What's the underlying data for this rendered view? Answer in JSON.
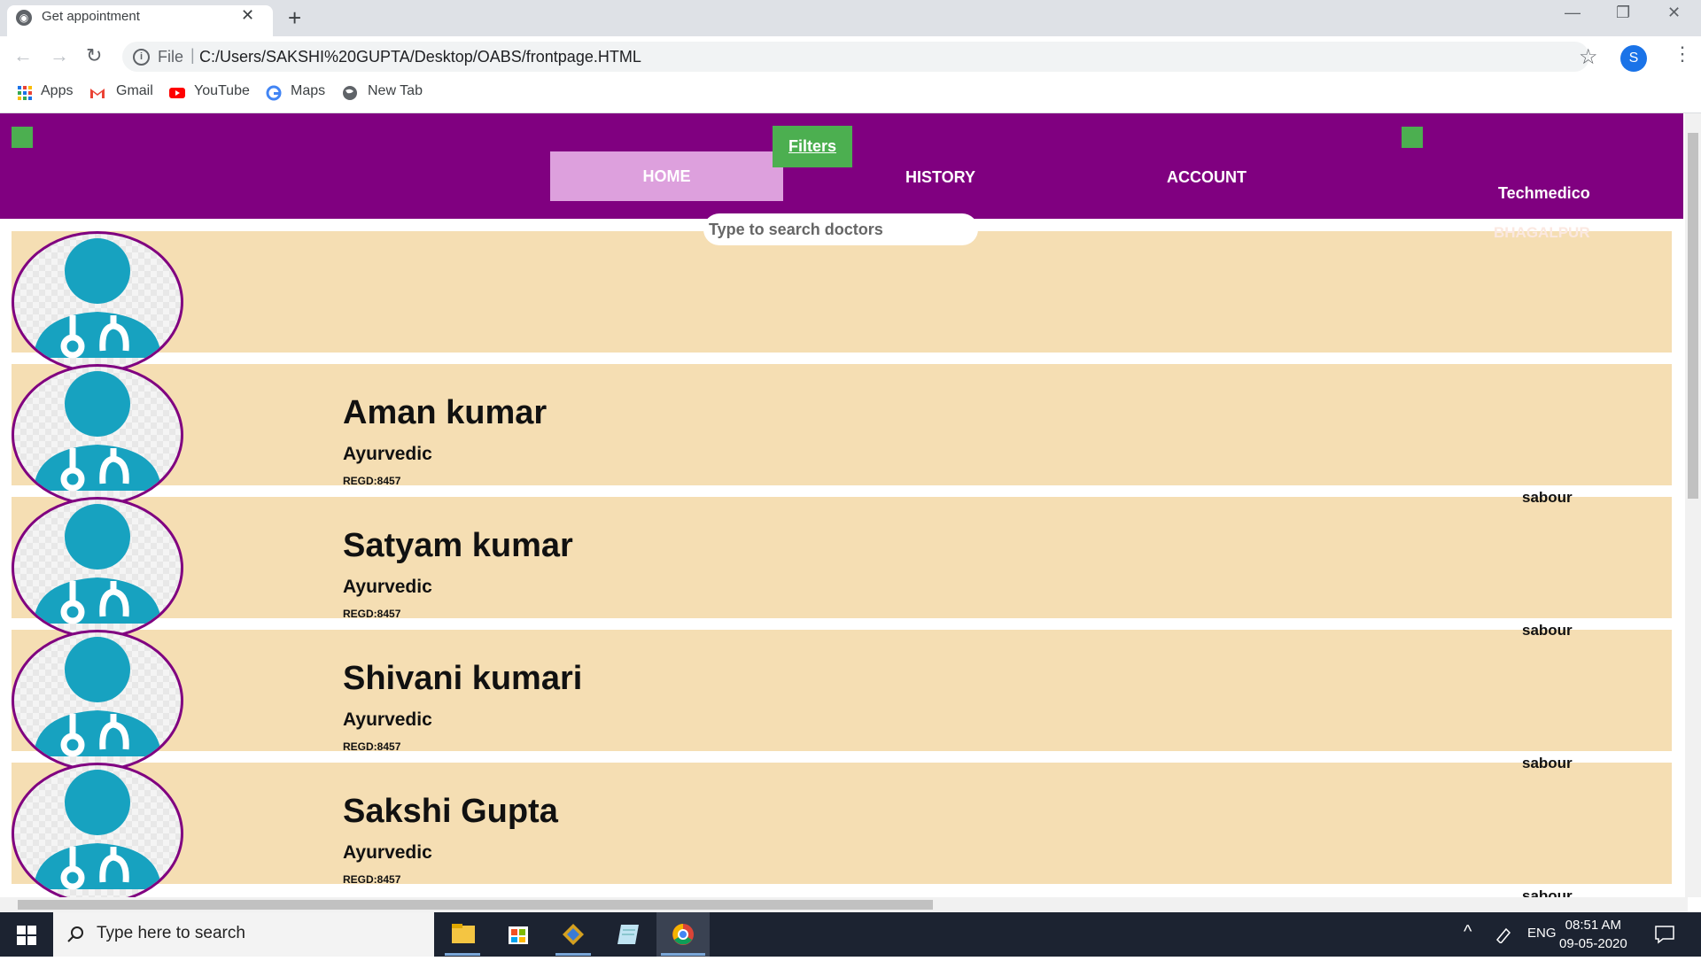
{
  "browser": {
    "tab_title": "Get appointment",
    "tab_close": "✕",
    "new_tab": "+",
    "window_controls": {
      "minimize": "—",
      "restore": "❐",
      "close": "✕"
    },
    "nav": {
      "back": "←",
      "forward": "→",
      "reload": "↻"
    },
    "omnibox": {
      "file_label": "File",
      "separator": "|",
      "url": "C:/Users/SAKSHI%20GUPTA/Desktop/OABS/frontpage.HTML"
    },
    "profile_initial": "S",
    "star": "☆",
    "menu": "⋮",
    "bookmarks": [
      {
        "label": "Apps",
        "icon": "apps-grid-icon"
      },
      {
        "label": "Gmail",
        "icon": "gmail-icon"
      },
      {
        "label": "YouTube",
        "icon": "youtube-icon"
      },
      {
        "label": "Maps",
        "icon": "google-icon"
      },
      {
        "label": "New Tab",
        "icon": "globe-icon"
      }
    ]
  },
  "page": {
    "nav": {
      "home": "HOME",
      "filters": "Filters ",
      "history": "HISTORY",
      "account": "ACCOUNT"
    },
    "brand": "Techmedico",
    "brand_sub": "BHAGALPUR",
    "search_placeholder": "Type to search doctors",
    "doctors": [
      {
        "name": "",
        "specialty": "",
        "regd": "",
        "location": ""
      },
      {
        "name": "Aman kumar",
        "specialty": "Ayurvedic",
        "regd": "REGD:8457",
        "location": "sabour"
      },
      {
        "name": "Satyam kumar",
        "specialty": "Ayurvedic",
        "regd": "REGD:8457",
        "location": "sabour"
      },
      {
        "name": "Shivani kumari",
        "specialty": "Ayurvedic",
        "regd": "REGD:8457",
        "location": "sabour"
      },
      {
        "name": "Sakshi Gupta",
        "specialty": "Ayurvedic",
        "regd": "REGD:8457",
        "location": "sabour"
      }
    ],
    "colors": {
      "header": "#800080",
      "card": "#f5deb3",
      "accent_green": "#4caf50",
      "home_active": "#dda0dd",
      "avatar_teal": "#17a2c0"
    }
  },
  "taskbar": {
    "search_placeholder": "Type here to search",
    "language": "ENG",
    "time": "08:51 AM",
    "date": "09-05-2020",
    "apps": [
      "file-explorer-icon",
      "store-icon",
      "app-icon",
      "notepad-icon",
      "chrome-icon"
    ]
  }
}
